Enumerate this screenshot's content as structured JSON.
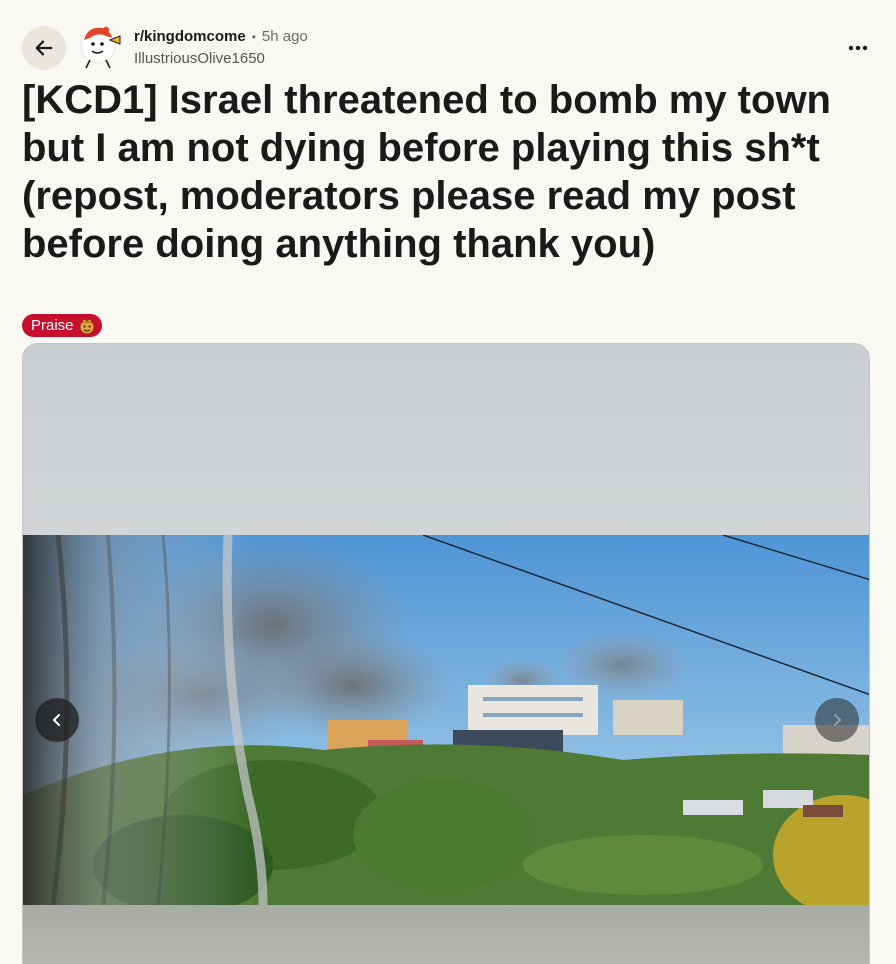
{
  "post": {
    "subreddit": "r/kingdomcome",
    "separator": "•",
    "time_ago": "5h ago",
    "author": "IllustriousOlive1650",
    "title": "[KCD1] Israel threatened to bomb my town but I am not dying before playing this sh*t (repost, moderators please read my post before doing anything thank you)",
    "flair": "Praise"
  },
  "icons": {
    "back": "arrow-left-icon",
    "more": "more-horizontal-icon",
    "prev": "chevron-left-icon",
    "next": "chevron-right-icon"
  },
  "colors": {
    "background": "#faf8f3",
    "flair": "#c8102e",
    "back_button_bg": "#ebe7dd"
  }
}
